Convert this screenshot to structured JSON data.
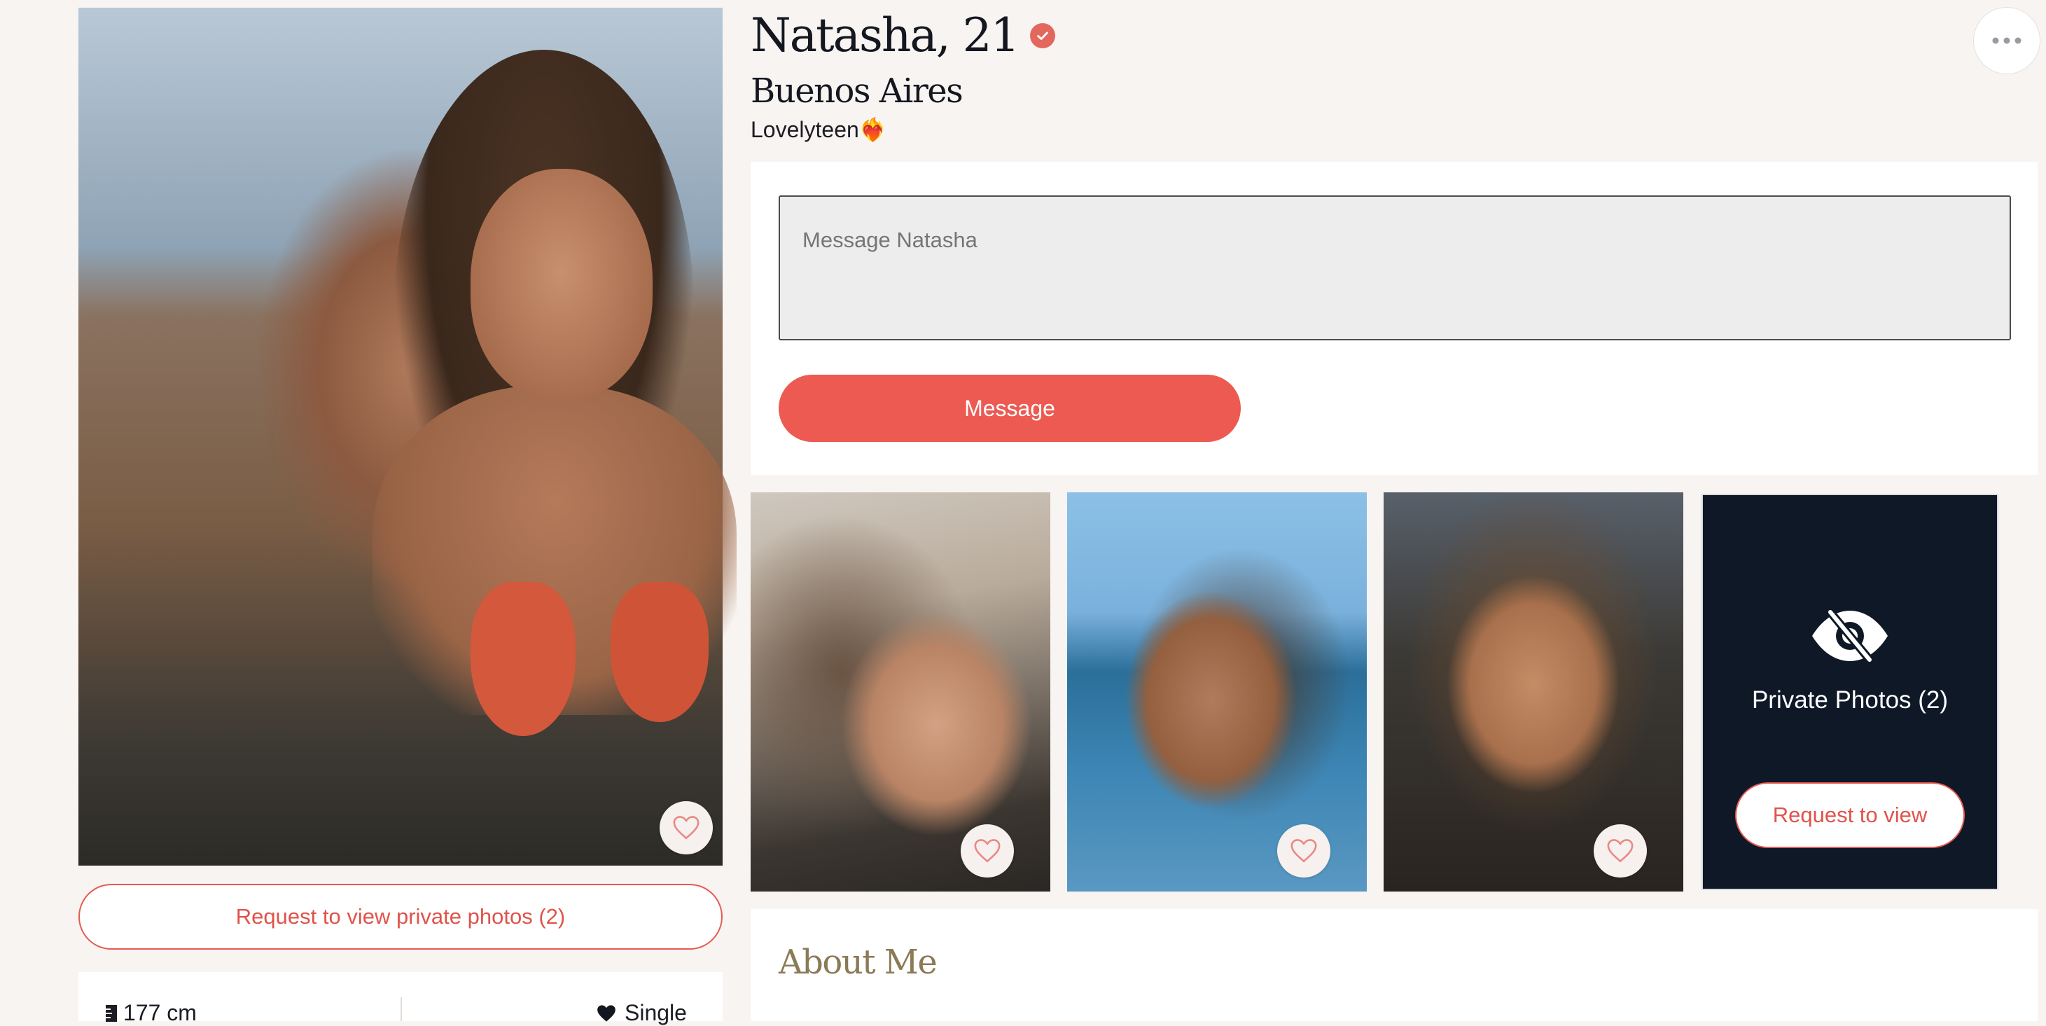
{
  "profile": {
    "name_age": "Natasha, 21",
    "city": "Buenos Aires",
    "tagline": "Lovelyteen❤️‍🔥",
    "verified": true
  },
  "actions": {
    "more_icon": "more-horizontal-icon",
    "request_private_label": "Request to view private photos (2)"
  },
  "stats": {
    "height": "177 cm",
    "height_icon": "ruler-icon",
    "relationship": "Single",
    "relationship_icon": "heart-icon"
  },
  "message": {
    "placeholder": "Message Natasha",
    "button_label": "Message"
  },
  "gallery": {
    "private_label": "Private Photos (2)",
    "private_icon": "eye-off-icon",
    "request_view_label": "Request to view"
  },
  "about": {
    "title": "About Me"
  },
  "colors": {
    "accent": "#ec5a52",
    "background": "#f7f4f1",
    "private_card": "#0f1827",
    "about_title": "#8b7a55"
  }
}
